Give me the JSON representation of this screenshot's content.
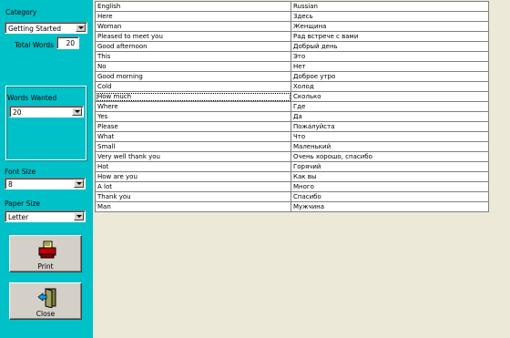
{
  "sidebar": {
    "category_label": "Category",
    "category_value": "Getting Started",
    "total_words_label": "Total Words",
    "total_words_value": "20",
    "words_wanted_label": "Words Wanted",
    "words_wanted_value": "20",
    "font_size_label": "Font Size",
    "font_size_value": "8",
    "paper_size_label": "Paper Size",
    "paper_size_value": "Letter",
    "print_label": "Print",
    "close_label": "Close"
  },
  "table": {
    "columns": [
      "English",
      "Russian"
    ],
    "rows": [
      [
        "Here",
        "Здесь"
      ],
      [
        "Woman",
        "Женщина"
      ],
      [
        "Pleased to meet you",
        "Рад встрече с вами"
      ],
      [
        "Good afternoon",
        "Добрый день"
      ],
      [
        "This",
        "Это"
      ],
      [
        "No",
        "Нет"
      ],
      [
        "Good morning",
        "Доброе утро"
      ],
      [
        "Cold",
        "Холод"
      ],
      [
        "How much",
        "Сколько"
      ],
      [
        "Where",
        "Где"
      ],
      [
        "Yes",
        "Да"
      ],
      [
        "Please",
        "Пожалуйста"
      ],
      [
        "What",
        "Что"
      ],
      [
        "Small",
        "Маленький"
      ],
      [
        "Very well thank you",
        "Очень хорошо, спасибо"
      ],
      [
        "Hot",
        "Горячий"
      ],
      [
        "How are you",
        "Как вы"
      ],
      [
        "A lot",
        "Много"
      ],
      [
        "Thank you",
        "Спасибо"
      ],
      [
        "Man",
        "Мужчина"
      ]
    ]
  },
  "icons": {
    "print": "printer-icon",
    "close": "door-exit-icon"
  },
  "colors": {
    "sidebar": "#00c0c8",
    "main_background": "#ece9d8"
  }
}
